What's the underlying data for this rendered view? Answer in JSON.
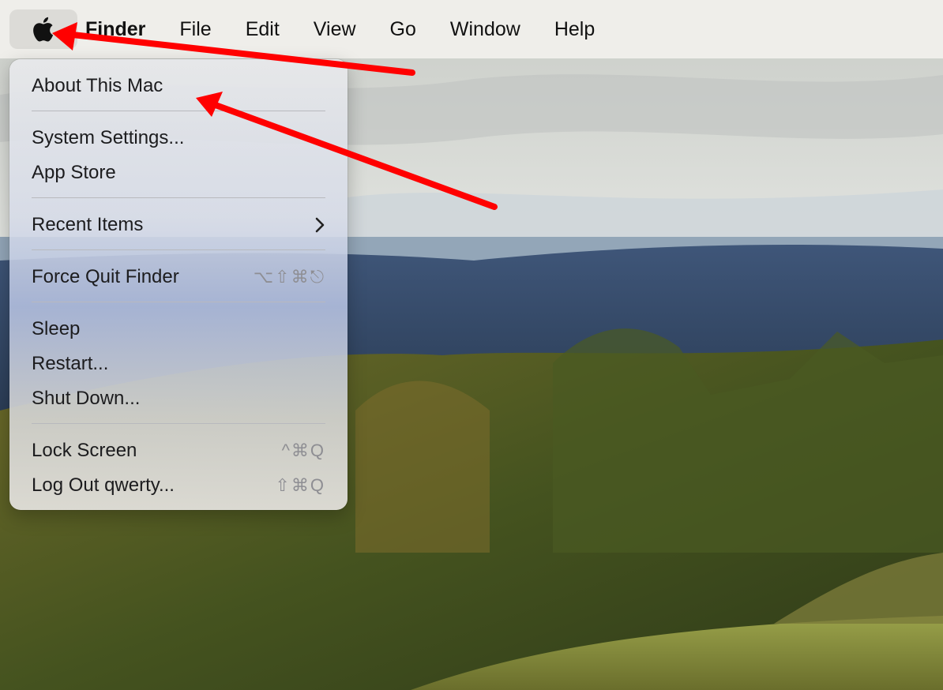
{
  "menubar": {
    "apple_icon": "apple-logo-icon",
    "items": [
      "Finder",
      "File",
      "Edit",
      "View",
      "Go",
      "Window",
      "Help"
    ]
  },
  "apple_menu": {
    "about": "About This Mac",
    "system_settings": "System Settings...",
    "app_store": "App Store",
    "recent_items": "Recent Items",
    "recent_items_icon": "chevron-right-icon",
    "force_quit": "Force Quit Finder",
    "force_quit_shortcut": "⌥⇧⌘⎋",
    "sleep": "Sleep",
    "restart": "Restart...",
    "shut_down": "Shut Down...",
    "lock_screen": "Lock Screen",
    "lock_screen_shortcut": "^⌘Q",
    "log_out": "Log Out qwerty...",
    "log_out_shortcut": "⇧⌘Q"
  },
  "colors": {
    "annotation_arrow": "#ff0000",
    "menubar_bg": "#efeeea"
  }
}
